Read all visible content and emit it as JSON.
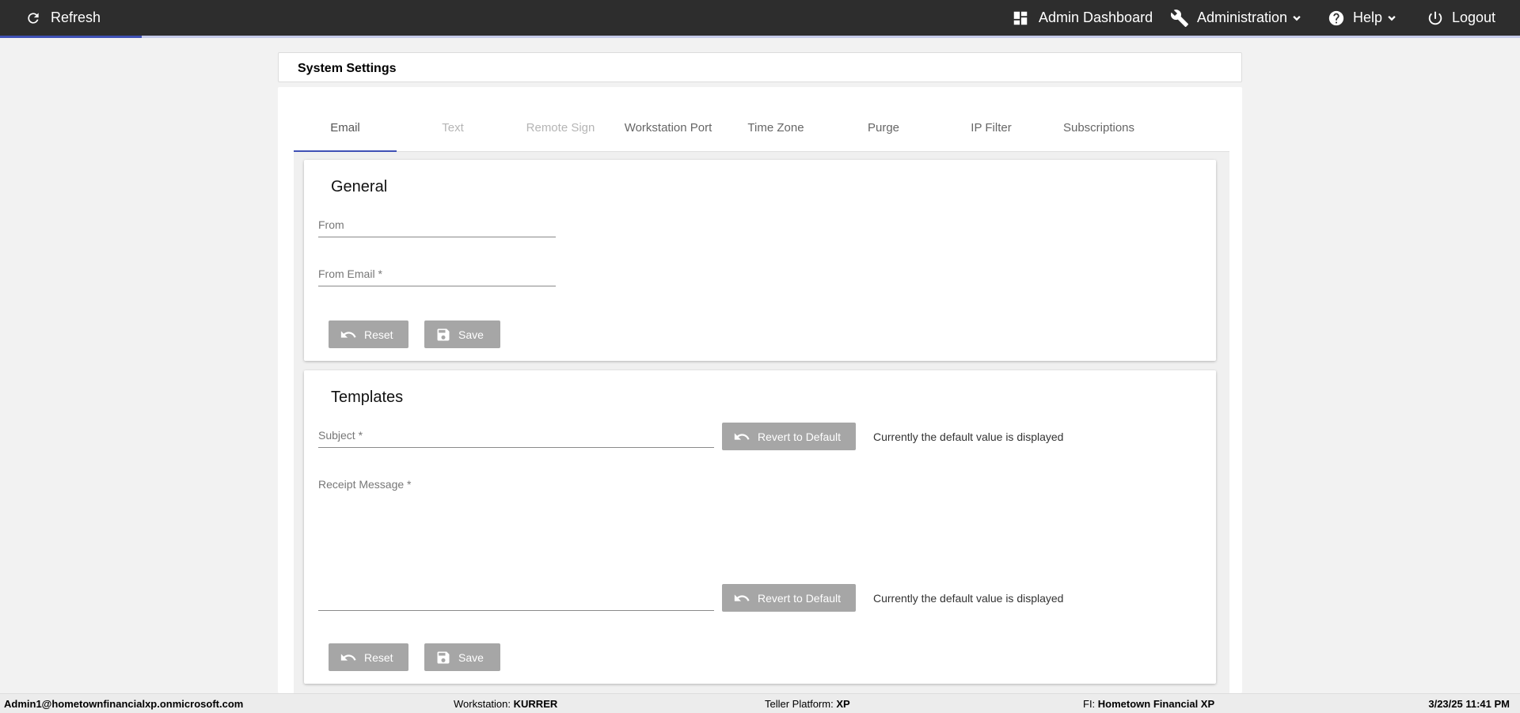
{
  "topbar": {
    "refresh_label": "Refresh",
    "admin_dashboard_label": "Admin Dashboard",
    "administration_label": "Administration",
    "help_label": "Help",
    "logout_label": "Logout",
    "progress_fraction": 0.093
  },
  "page": {
    "title": "System Settings"
  },
  "tabs": [
    {
      "label": "Email",
      "state": "active"
    },
    {
      "label": "Text",
      "state": "disabled"
    },
    {
      "label": "Remote Sign",
      "state": "disabled"
    },
    {
      "label": "Workstation Port",
      "state": "enabled"
    },
    {
      "label": "Time Zone",
      "state": "enabled"
    },
    {
      "label": "Purge",
      "state": "enabled"
    },
    {
      "label": "IP Filter",
      "state": "enabled"
    },
    {
      "label": "Subscriptions",
      "state": "enabled"
    }
  ],
  "general": {
    "title": "General",
    "from_label": "From",
    "from_email_label": "From Email *",
    "reset_label": "Reset",
    "save_label": "Save"
  },
  "templates": {
    "title": "Templates",
    "subject_label": "Subject *",
    "receipt_message_label": "Receipt Message *",
    "revert_label": "Revert to Default",
    "default_note": "Currently the default value is displayed",
    "reset_label": "Reset",
    "save_label": "Save"
  },
  "statusbar": {
    "user": "Admin1@hometownfinancialxp.onmicrosoft.com",
    "workstation_label": "Workstation:",
    "workstation_value": "KURRER",
    "teller_platform_label": "Teller Platform:",
    "teller_platform_value": "XP",
    "fi_label": "FI:",
    "fi_value": "Hometown Financial XP",
    "datetime": "3/23/25 11:41 PM"
  },
  "colors": {
    "topbar_bg": "#2d2d2d",
    "accent": "#3f51b5",
    "button_disabled": "#a6a6a6"
  }
}
